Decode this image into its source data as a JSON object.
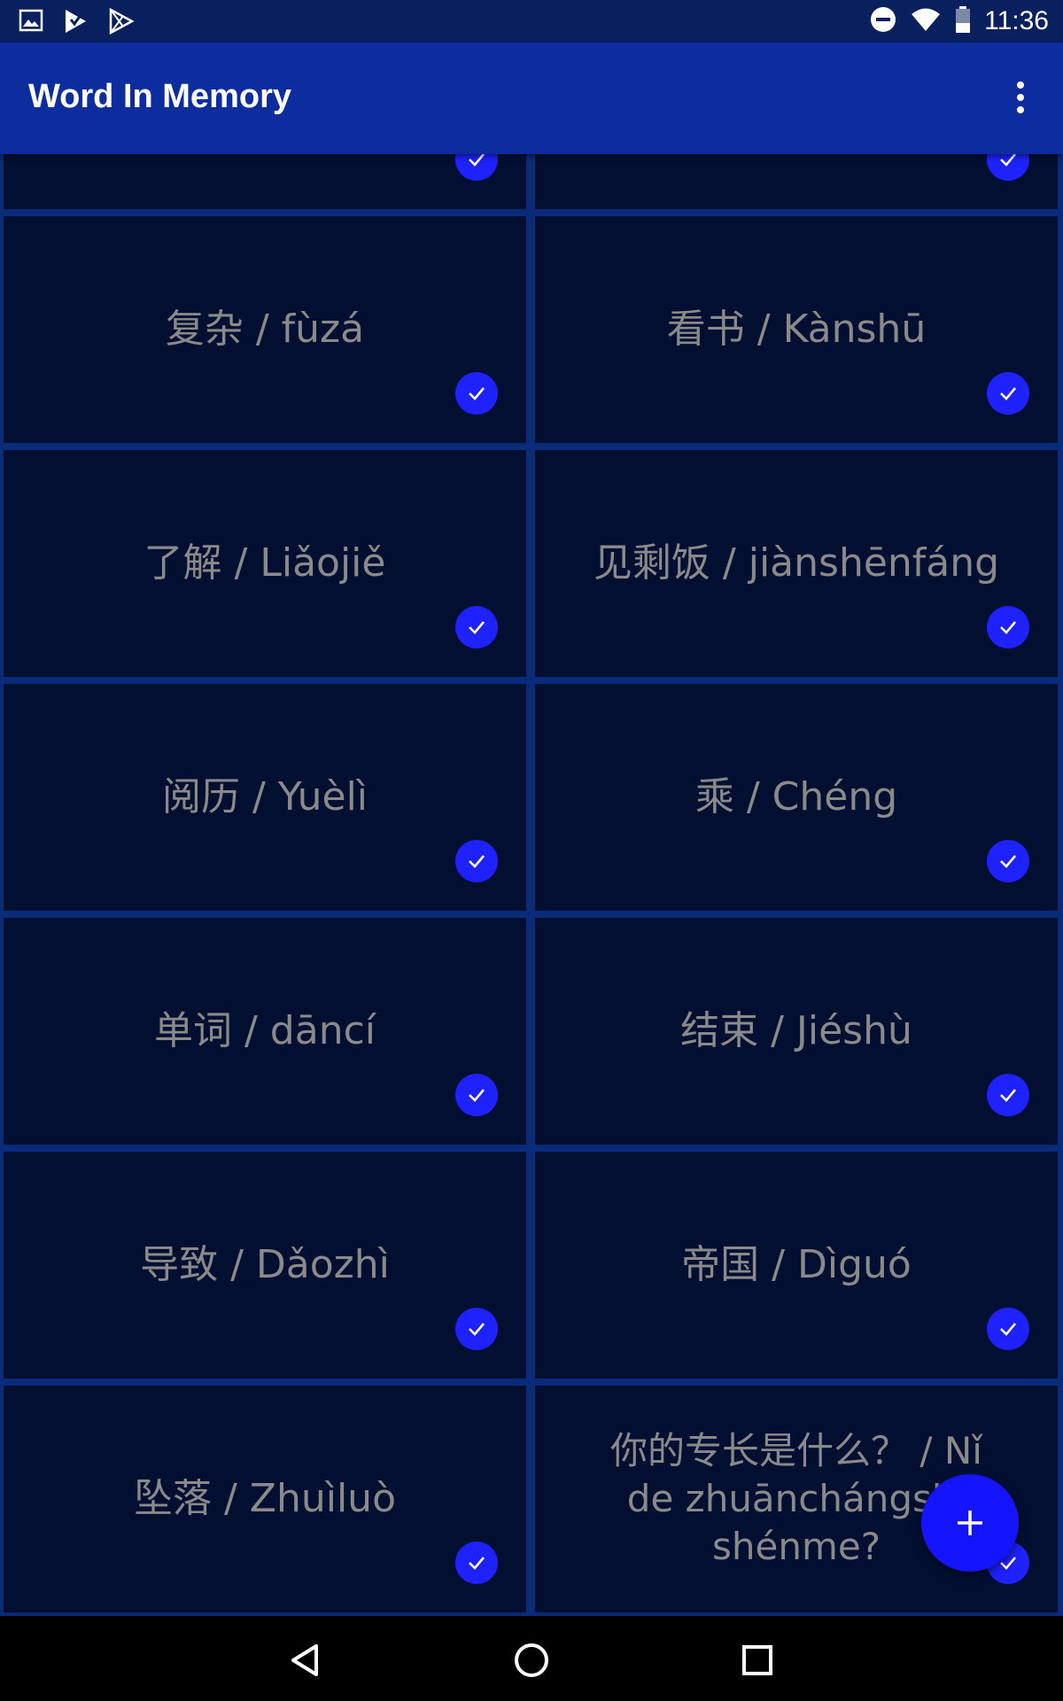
{
  "status_bar": {
    "time": "11:36",
    "left_icons": [
      "image-icon",
      "play-store-icon",
      "play-store-outline-icon"
    ],
    "right_icons": [
      "do-not-disturb-icon",
      "wifi-icon",
      "battery-icon"
    ]
  },
  "app_bar": {
    "title": "Word In Memory",
    "menu_icon": "more-vert-icon"
  },
  "cards": [
    {
      "text": "",
      "learned": true
    },
    {
      "text": "",
      "learned": true
    },
    {
      "text": "复杂 / fùzá",
      "learned": true
    },
    {
      "text": "看书 / Kànshū",
      "learned": true
    },
    {
      "text": "了解 / Liǎojiě",
      "learned": true
    },
    {
      "text": "见剩饭 / jiànshēnfáng",
      "learned": true
    },
    {
      "text": "阅历 / Yuèlì",
      "learned": true
    },
    {
      "text": "乘 / Chéng",
      "learned": true
    },
    {
      "text": "单词 / dāncí",
      "learned": true
    },
    {
      "text": "结束 / Jiéshù",
      "learned": true
    },
    {
      "text": "导致 / Dǎozhì",
      "learned": true
    },
    {
      "text": "帝国 / Dìguó",
      "learned": true
    },
    {
      "text": "坠落 / Zhuìluò",
      "learned": true
    },
    {
      "text": "你的专长是什么？ / Nǐ de zhuānchángshì shénme?",
      "learned": true
    }
  ],
  "fab": {
    "icon": "plus-icon"
  },
  "nav_bar": {
    "icons": [
      "back-icon",
      "home-icon",
      "recents-icon"
    ]
  },
  "colors": {
    "status_bar": "#08215e",
    "app_bar": "#0d2c9e",
    "background": "#0a2a7a",
    "card": "#020f31",
    "card_text": "#8a8a8a",
    "check": "#1d22ff",
    "fab": "#1414ff"
  }
}
